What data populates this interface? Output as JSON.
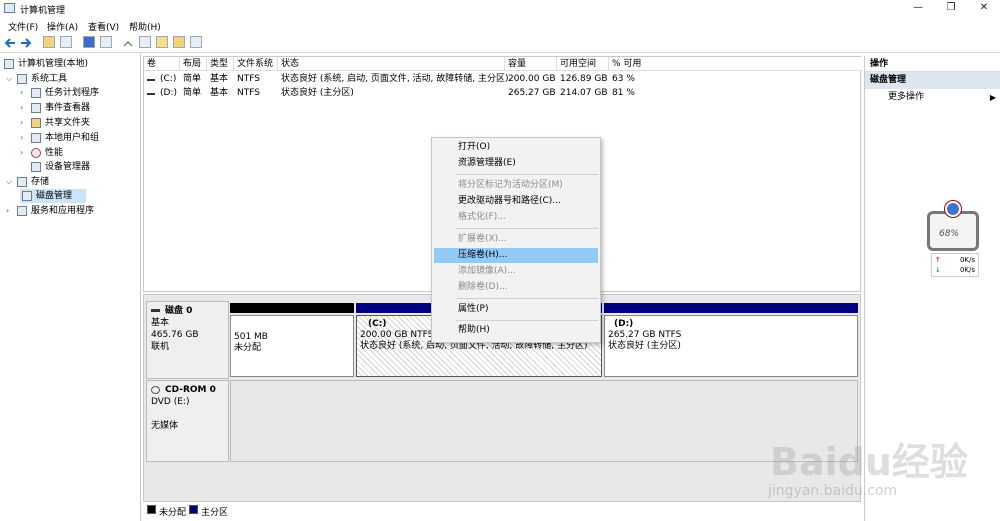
{
  "window": {
    "title": "计算机管理",
    "controls": [
      "—",
      "❐",
      "✕"
    ]
  },
  "menu": [
    "文件(F)",
    "操作(A)",
    "查看(V)",
    "帮助(H)"
  ],
  "toolbar": {
    "icons": [
      "back-icon",
      "forward-icon",
      "up-folder-icon",
      "show-tree-icon",
      "help-icon",
      "properties-icon",
      "connect-icon",
      "check-icon",
      "export-icon",
      "help-topic-icon",
      "console-icon"
    ]
  },
  "tree": {
    "root": "计算机管理(本地)",
    "system_tools": "系统工具",
    "task_scheduler": "任务计划程序",
    "event_viewer": "事件查看器",
    "shared_folders": "共享文件夹",
    "local_users": "本地用户和组",
    "performance": "性能",
    "device_manager": "设备管理器",
    "storage": "存储",
    "disk_management": "磁盘管理",
    "services": "服务和应用程序"
  },
  "volume_table": {
    "headers": [
      "卷",
      "布局",
      "类型",
      "文件系统",
      "状态",
      "容量",
      "可用空间",
      "% 可用"
    ],
    "rows": [
      [
        "(C:)",
        "简单",
        "基本",
        "NTFS",
        "状态良好 (系统, 启动, 页面文件, 活动, 故障转储, 主分区)",
        "200.00 GB",
        "126.89 GB",
        "63 %"
      ],
      [
        "(D:)",
        "简单",
        "基本",
        "NTFS",
        "状态良好 (主分区)",
        "265.27 GB",
        "214.07 GB",
        "81 %"
      ]
    ]
  },
  "disk0": {
    "name": "磁盘 0",
    "type": "基本",
    "size": "465.76 GB",
    "status": "联机",
    "unalloc_size": "501 MB",
    "unalloc_label": "未分配",
    "c_title": "(C:)",
    "c_size": "200.00 GB NTFS",
    "c_status": "状态良好 (系统, 启动, 页面文件, 活动, 故障转储, 主分区)",
    "d_title": "(D:)",
    "d_size": "265.27 GB NTFS",
    "d_status": "状态良好 (主分区)"
  },
  "cdrom": {
    "name": "CD-ROM 0",
    "drive": "DVD (E:)",
    "media": "无媒体"
  },
  "legend": {
    "unallocated": "未分配",
    "primary": "主分区"
  },
  "actions": {
    "header": "操作",
    "section": "磁盘管理",
    "more": "更多操作"
  },
  "context_menu": {
    "open": "打开(O)",
    "explorer": "资源管理器(E)",
    "mark_active": "将分区标记为活动分区(M)",
    "change_letter": "更改驱动器号和路径(C)...",
    "format": "格式化(F)...",
    "extend": "扩展卷(X)...",
    "shrink": "压缩卷(H)...",
    "add_mirror": "添加镜像(A)...",
    "delete": "删除卷(D)...",
    "properties": "属性(P)",
    "help": "帮助(H)"
  },
  "net_widget": {
    "percent": "68%",
    "up": "0K/s",
    "down": "0K/s"
  },
  "watermark": {
    "brand": "Baidu经验",
    "url": "jingyan.baidu.com"
  },
  "colors": {
    "unallocated": "#000000",
    "primary": "#000080",
    "highlight": "#91c9f7"
  }
}
